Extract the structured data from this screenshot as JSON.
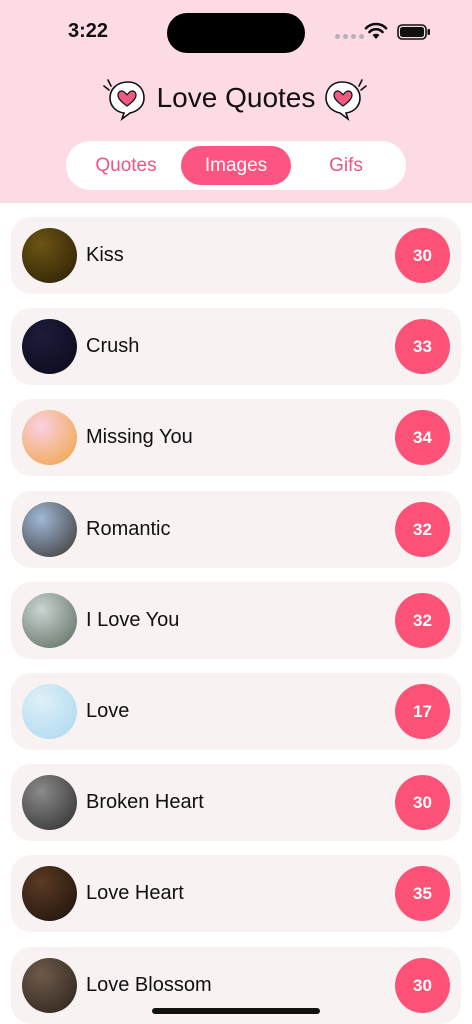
{
  "status_bar": {
    "time": "3:22"
  },
  "header": {
    "title": "Love Quotes"
  },
  "tabs": [
    {
      "label": "Quotes",
      "selected": false
    },
    {
      "label": "Images",
      "selected": true
    },
    {
      "label": "Gifs",
      "selected": false
    }
  ],
  "categories": [
    {
      "label": "Kiss",
      "count": "30",
      "thumb_colors": [
        "#6b5414",
        "#2b1d06"
      ]
    },
    {
      "label": "Crush",
      "count": "33",
      "thumb_colors": [
        "#1d1b3a",
        "#0b0a1a"
      ]
    },
    {
      "label": "Missing You",
      "count": "34",
      "thumb_colors": [
        "#f9d1e3",
        "#f0a23c"
      ]
    },
    {
      "label": "Romantic",
      "count": "32",
      "thumb_colors": [
        "#9fb9d6",
        "#3a3330"
      ]
    },
    {
      "label": "I Love You",
      "count": "32",
      "thumb_colors": [
        "#c9d4d2",
        "#5a6a5c"
      ]
    },
    {
      "label": "Love",
      "count": "17",
      "thumb_colors": [
        "#dff0f8",
        "#a9d8ee"
      ]
    },
    {
      "label": "Broken Heart",
      "count": "30",
      "thumb_colors": [
        "#8a8a8a",
        "#2c2c2c"
      ]
    },
    {
      "label": "Love Heart",
      "count": "35",
      "thumb_colors": [
        "#5a3a24",
        "#1c120a"
      ]
    },
    {
      "label": "Love Blossom",
      "count": "30",
      "thumb_colors": [
        "#6e5a4a",
        "#2a221c"
      ]
    }
  ],
  "colors": {
    "header_bg": "#fcdbe4",
    "accent": "#fc5581",
    "row_bg": "#f8f3f2"
  }
}
